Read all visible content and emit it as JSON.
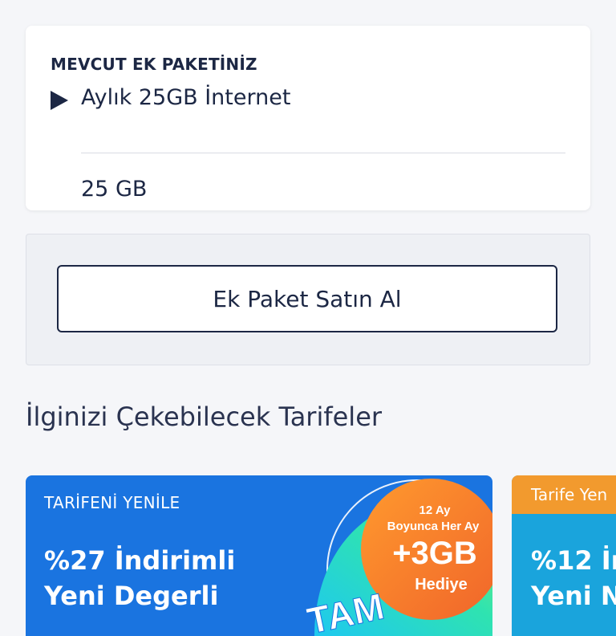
{
  "current_package": {
    "section_title": "MEVCUT EK PAKETİNİZ",
    "name": "Aylık 25GB İnternet",
    "amount": "25 GB"
  },
  "buy": {
    "button_label": "Ek Paket Satın Al"
  },
  "tariffs": {
    "heading": "İlginizi Çekebilecek Tarifeler",
    "cards": [
      {
        "tag": "TARİFENİ YENİLE",
        "title_line1": "%27 İndirimli",
        "title_line2": "Yeni Degerli",
        "badge_line1": "12 Ay",
        "badge_line2": "Boyunca Her Ay",
        "badge_big": "+3GB",
        "badge_line3": "Hediye",
        "promo_word": "TAM",
        "color": "#1a74e0"
      },
      {
        "tag": "Tarife Yen",
        "title_line1": "%12 İn",
        "title_line2": "Yeni N",
        "color": "#1aa4dc",
        "tag_color": "#f29a2e"
      }
    ]
  }
}
